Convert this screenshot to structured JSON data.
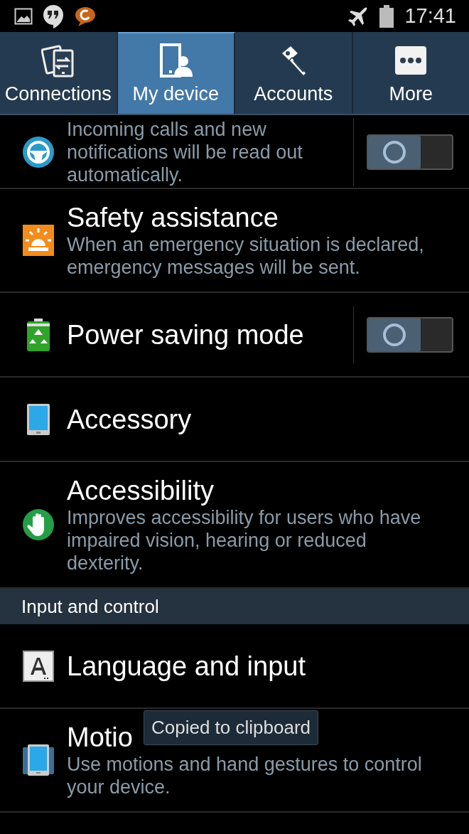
{
  "status_bar": {
    "time": "17:41"
  },
  "tabs": [
    {
      "label": "Connections",
      "selected": false
    },
    {
      "label": "My device",
      "selected": true
    },
    {
      "label": "Accounts",
      "selected": false
    },
    {
      "label": "More",
      "selected": false
    }
  ],
  "settings": [
    {
      "kind": "item",
      "description": "Incoming calls and new notifications will be read out automatically.",
      "on": false
    },
    {
      "kind": "item",
      "title": "Safety assistance",
      "description": "When an emergency situation is declared, emergency messages will be sent."
    },
    {
      "kind": "item",
      "title": "Power saving mode",
      "on": false
    },
    {
      "kind": "item",
      "title": "Accessory"
    },
    {
      "kind": "item",
      "title": "Accessibility",
      "description": "Improves accessibility for users who have impaired vision, hearing or reduced dexterity."
    },
    {
      "kind": "header",
      "title": "Input and control"
    },
    {
      "kind": "item",
      "title": "Language and input"
    },
    {
      "kind": "item",
      "title": "Motio",
      "description": "Use motions and hand gestures to control your device."
    },
    {
      "kind": "item"
    }
  ],
  "toast": {
    "text": "Copied to clipboard"
  }
}
